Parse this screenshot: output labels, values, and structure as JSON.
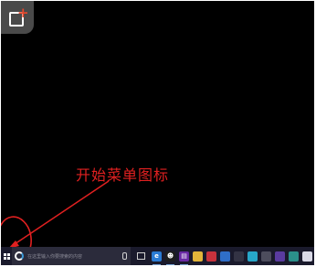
{
  "annotation": {
    "text": "开始菜单图标",
    "color": "#e02020"
  },
  "taskbar": {
    "start_icon": "windows-logo-icon",
    "search_placeholder": "在这里输入你要搜索的内容",
    "mic_icon": "microphone-icon",
    "task_view_icon": "task-view-icon",
    "apps": [
      {
        "icon": "edge-icon",
        "color": "#2a7bd5",
        "glyph": "e"
      },
      {
        "icon": "qq-icon",
        "color": "#1e1e1e",
        "glyph": "☻"
      },
      {
        "icon": "store-icon",
        "color": "#6a2aa5",
        "glyph": "▤"
      },
      {
        "icon": "folder-icon",
        "color": "#e2b53a",
        "glyph": ""
      },
      {
        "icon": "app-red-icon",
        "color": "#c8323c",
        "glyph": ""
      },
      {
        "icon": "app-blue-icon",
        "color": "#2f6ec8",
        "glyph": ""
      },
      {
        "icon": "app-dark-icon",
        "color": "#333344",
        "glyph": ""
      },
      {
        "icon": "app-cyan-icon",
        "color": "#27a6c9",
        "glyph": ""
      },
      {
        "icon": "app-gray-icon",
        "color": "#4d4d5d",
        "glyph": ""
      },
      {
        "icon": "app-purple-icon",
        "color": "#5a3ba0",
        "glyph": ""
      },
      {
        "icon": "app-teal-icon",
        "color": "#2b8f8a",
        "glyph": ""
      },
      {
        "icon": "app-white-icon",
        "color": "#d9d9e6",
        "glyph": ""
      }
    ]
  },
  "watermark": {
    "logo_icon": "watermark-logo-icon",
    "accent": "#e4472c"
  }
}
